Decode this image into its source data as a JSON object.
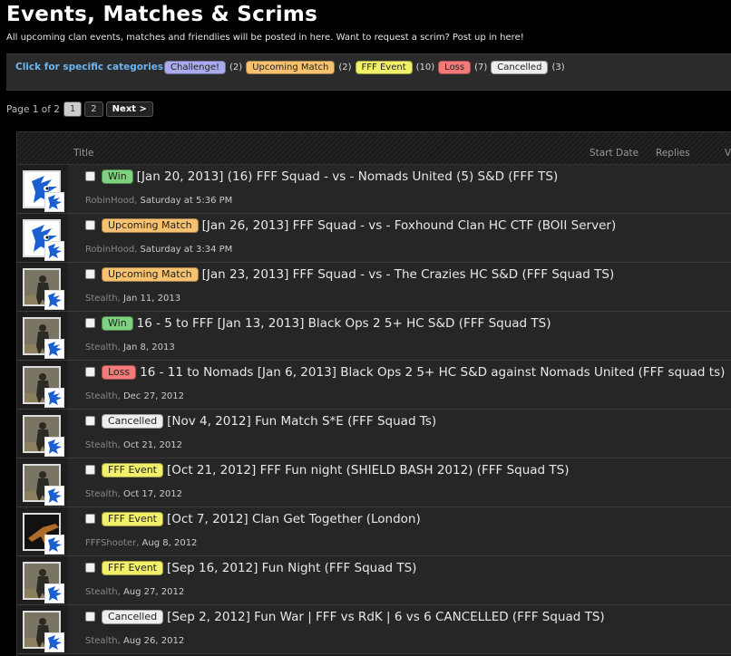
{
  "page": {
    "title": "Events, Matches & Scrims",
    "description": "All upcoming clan events, matches and friendlies will be posted in here. Want to request a scrim? Post up in here!"
  },
  "categories": {
    "label": "Click for specific categories:",
    "items": [
      {
        "name": "Challenge!",
        "count": "(2)",
        "color": "#aaaaee"
      },
      {
        "name": "Upcoming Match",
        "count": "(2)",
        "color": "#f6c26f"
      },
      {
        "name": "FFF Event",
        "count": "(10)",
        "color": "#f2f06a"
      },
      {
        "name": "Loss",
        "count": "(7)",
        "color": "#f47a7a"
      },
      {
        "name": "Cancelled",
        "count": "(3)",
        "color": "#eeeeee"
      }
    ]
  },
  "pagenav": {
    "info": "Page 1 of 2",
    "pages": [
      "1",
      "2"
    ],
    "next": "Next >"
  },
  "list_header": {
    "title": "Title",
    "start_date": "Start Date",
    "replies": "Replies",
    "views": "V"
  },
  "threads": [
    {
      "prefix": "Win",
      "prefix_color": "#7ed17e",
      "title": "[Jan 20, 2013] (16) FFF Squad - vs - Nomads United (5) S&D (FFF TS)",
      "author": "RobinHood",
      "date": "Saturday at 5:36 PM",
      "avatar": "sonic-avatar"
    },
    {
      "prefix": "Upcoming Match",
      "prefix_color": "#f6c26f",
      "title": "[Jan 26, 2013] FFF Squad - vs - Foxhound Clan HC CTF (BOII Server)",
      "author": "RobinHood",
      "date": "Saturday at 3:34 PM",
      "avatar": "sonic-avatar"
    },
    {
      "prefix": "Upcoming Match",
      "prefix_color": "#f6c26f",
      "title": "[Jan 23, 2013] FFF Squad - vs - The Crazies HC S&D (FFF Squad TS)",
      "author": "Stealth",
      "date": "Jan 11, 2013",
      "avatar": "soldier-avatar"
    },
    {
      "prefix": "Win",
      "prefix_color": "#7ed17e",
      "title": "16 - 5 to FFF [Jan 13, 2013] Black Ops 2 5+ HC S&D (FFF Squad TS)",
      "author": "Stealth",
      "date": "Jan 8, 2013",
      "avatar": "soldier-avatar"
    },
    {
      "prefix": "Loss",
      "prefix_color": "#f47a7a",
      "title": "16 - 11 to Nomads [Jan 6, 2013] Black Ops 2 5+ HC S&D against Nomads United (FFF squad ts)",
      "author": "Stealth",
      "date": "Dec 27, 2012",
      "avatar": "soldier-avatar"
    },
    {
      "prefix": "Cancelled",
      "prefix_color": "#eeeeee",
      "title": "[Nov 4, 2012] Fun Match S*E (FFF Squad Ts)",
      "author": "Stealth",
      "date": "Oct 21, 2012",
      "avatar": "soldier-avatar"
    },
    {
      "prefix": "FFF Event",
      "prefix_color": "#f2f06a",
      "title": "[Oct 21, 2012] FFF Fun night (SHIELD BASH 2012) (FFF Squad TS)",
      "author": "Stealth",
      "date": "Oct 17, 2012",
      "avatar": "soldier-avatar"
    },
    {
      "prefix": "FFF Event",
      "prefix_color": "#f2f06a",
      "title": "[Oct 7, 2012] Clan Get Together (London)",
      "author": "FFFShooter",
      "date": "Aug 8, 2012",
      "avatar": "gun-avatar"
    },
    {
      "prefix": "FFF Event",
      "prefix_color": "#f2f06a",
      "title": "[Sep 16, 2012] Fun Night (FFF Squad TS)",
      "author": "Stealth",
      "date": "Aug 27, 2012",
      "avatar": "soldier-avatar"
    },
    {
      "prefix": "Cancelled",
      "prefix_color": "#eeeeee",
      "title": "[Sep 2, 2012] Fun War | FFF vs RdK | 6 vs 6 CANCELLED (FFF Squad TS)",
      "author": "Stealth",
      "date": "Aug 26, 2012",
      "avatar": "soldier-avatar"
    }
  ]
}
